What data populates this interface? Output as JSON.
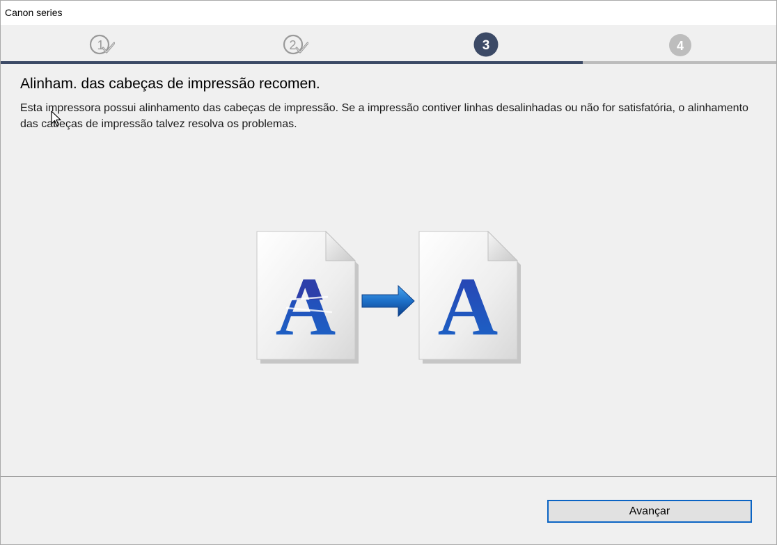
{
  "window": {
    "title": "Canon series"
  },
  "steps": [
    {
      "number": "1",
      "status": "completed",
      "icon": "circled-one-check-icon"
    },
    {
      "number": "2",
      "status": "completed",
      "icon": "circled-two-check-icon"
    },
    {
      "number": "3",
      "status": "current",
      "icon": "circled-three-filled-icon"
    },
    {
      "number": "4",
      "status": "pending",
      "icon": "circled-four-gray-icon"
    }
  ],
  "progress": {
    "fraction": 0.75
  },
  "content": {
    "heading": "Alinham. das cabeças de impressão recomen.",
    "description": "Esta impressora possui alinhamento das cabeças de impressão. Se a impressão contiver linhas desalinhadas ou não for satisfatória, o alinhamento das cabeças de impressão talvez resolva os problemas.",
    "illustration": {
      "before_letter": "A",
      "after_letter": "A",
      "before_icon": "misaligned-document-icon",
      "arrow_icon": "right-arrow-icon",
      "after_icon": "aligned-document-icon"
    }
  },
  "footer": {
    "next_label": "Avançar"
  },
  "colors": {
    "accent": "#3c4a66",
    "completed_step": "#9a9a9a",
    "pending_step": "#bdbdbd",
    "letter_blue": "#1d4fb0",
    "button_focus": "#0a64c4"
  }
}
